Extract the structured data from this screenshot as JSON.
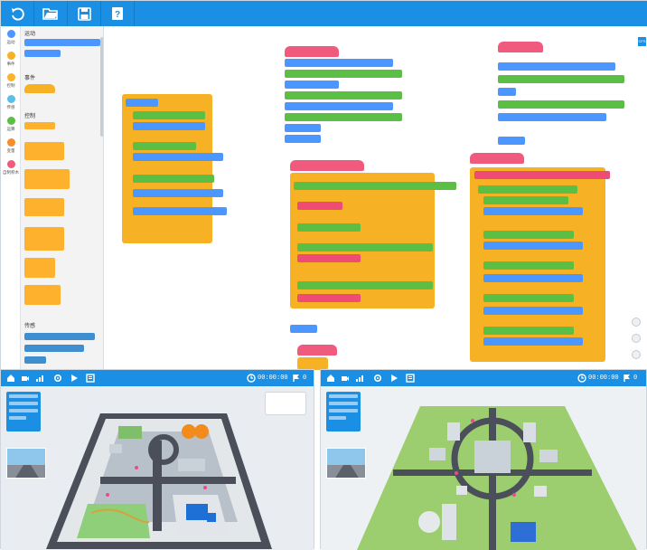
{
  "toolbar": {
    "items": [
      "undo-icon",
      "open-folder-icon",
      "save-icon",
      "help-icon"
    ],
    "help_label": "?"
  },
  "categories": [
    {
      "label": "运动",
      "color": "#4c97ff"
    },
    {
      "label": "事件",
      "color": "#f7b125"
    },
    {
      "label": "控制",
      "color": "#fdb12c"
    },
    {
      "label": "传感",
      "color": "#5bbfe8"
    },
    {
      "label": "运算",
      "color": "#5bbf45"
    },
    {
      "label": "变量",
      "color": "#f78c2c"
    },
    {
      "label": "自制积木",
      "color": "#f05b7d"
    }
  ],
  "palette": {
    "section_motion": "运动",
    "section_event": "事件",
    "section_control": "控制",
    "section_sensing": "传感"
  },
  "side_tab": "CFS",
  "simulators": [
    {
      "name": "left",
      "timer": "00:00:00",
      "counter": "0"
    },
    {
      "name": "right",
      "timer": "00:00:00",
      "counter": "0"
    }
  ],
  "colors": {
    "accent": "#1b8fe3",
    "motion": "#4c97ff",
    "event": "#f7b125",
    "operators": "#5bbf45",
    "custom": "#f05b7d",
    "map_green": "#9ccd6f",
    "road": "#4a4f59"
  }
}
